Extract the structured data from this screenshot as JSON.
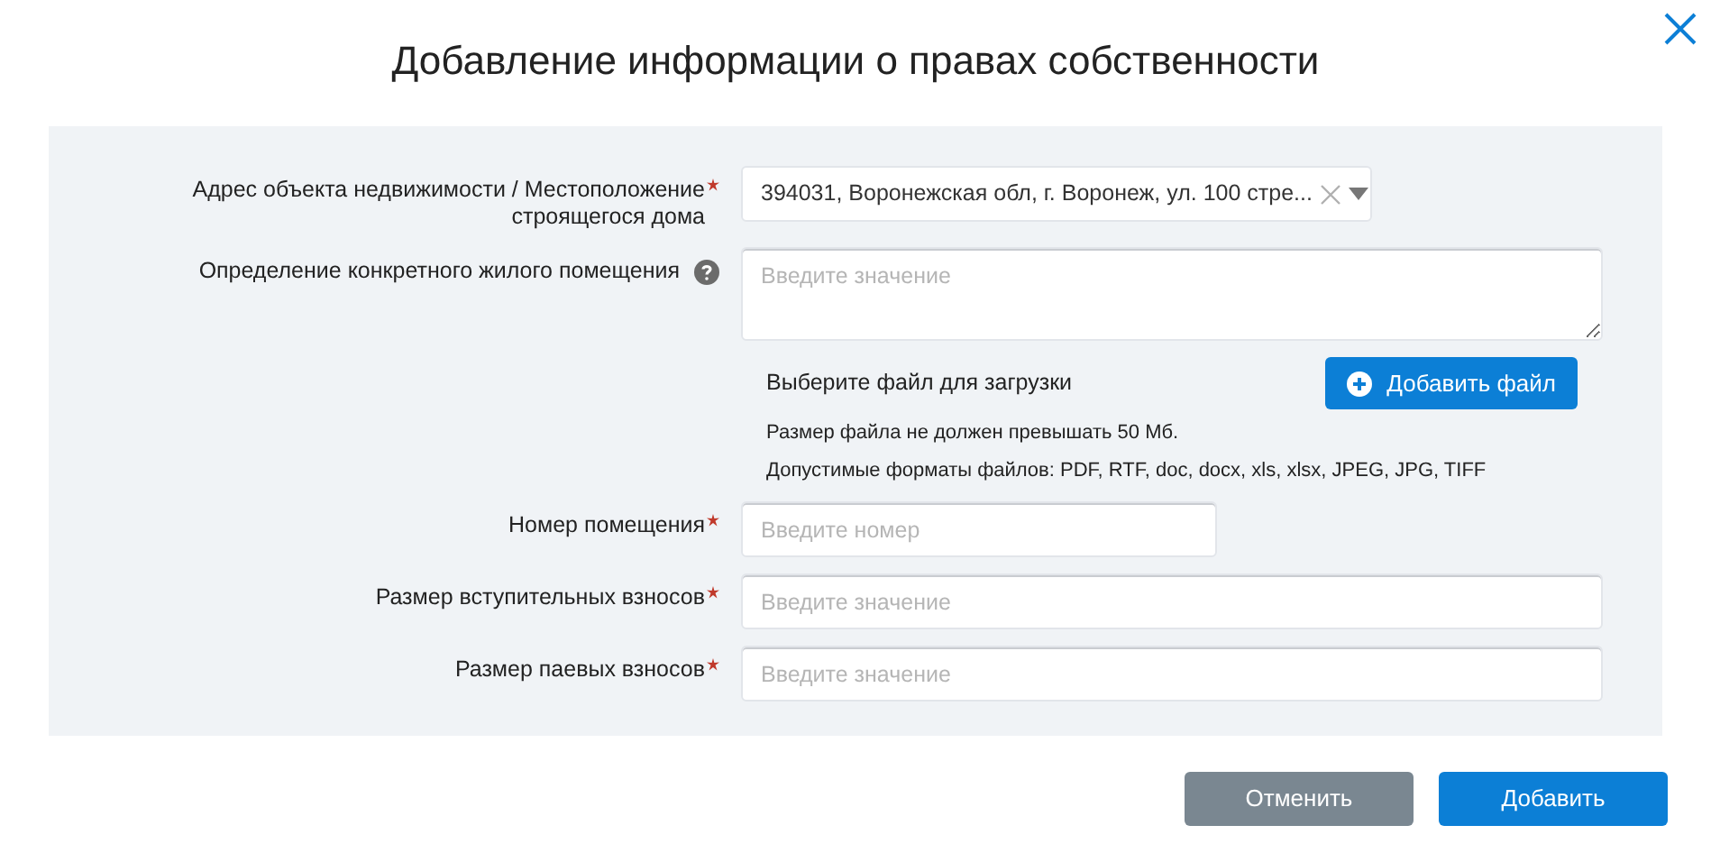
{
  "title": "Добавление информации о правах собственности",
  "fields": [
    {
      "kind": "select",
      "label": "Адрес объекта недвижимости / Местоположение строящегося дома",
      "required": true,
      "value": "394031, Воронежская обл, г. Воронеж, ул. 100 стре..."
    },
    {
      "kind": "textarea",
      "label": "Определение конкретного жилого помещения",
      "required": false,
      "help": true,
      "placeholder": "Введите значение"
    },
    {
      "kind": "file",
      "prompt": "Выберите файл для загрузки",
      "button": "Добавить файл",
      "notes": [
        "Размер файла не должен превышать 50 Мб.",
        "Допустимые форматы файлов: PDF, RTF, doc, docx, xls, xlsx, JPEG, JPG, TIFF"
      ]
    },
    {
      "kind": "short_input",
      "label": "Номер помещения",
      "required": true,
      "placeholder": "Введите номер"
    },
    {
      "kind": "input",
      "label": "Размер вступительных взносов",
      "required": true,
      "placeholder": "Введите значение"
    },
    {
      "kind": "input",
      "label": "Размер паевых взносов",
      "required": true,
      "placeholder": "Введите значение"
    }
  ],
  "buttons": [
    {
      "kind": "secondary",
      "label": "Отменить"
    },
    {
      "kind": "primary",
      "label": "Добавить"
    }
  ]
}
